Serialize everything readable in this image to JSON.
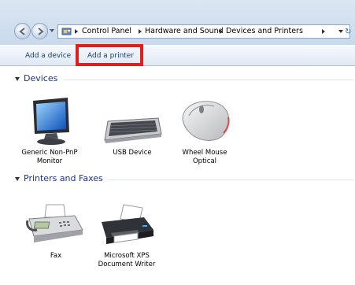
{
  "breadcrumb": [
    "Control Panel",
    "Hardware and Sound",
    "Devices and Printers"
  ],
  "toolbar": {
    "add_device": "Add a device",
    "add_printer": "Add a printer"
  },
  "groups": {
    "devices": {
      "title": "Devices",
      "items": [
        {
          "label": "Generic Non-PnP Monitor",
          "icon": "monitor-icon"
        },
        {
          "label": "USB Device",
          "icon": "keyboard-icon"
        },
        {
          "label": "Wheel Mouse Optical",
          "icon": "mouse-icon"
        }
      ]
    },
    "printers": {
      "title": "Printers and Faxes",
      "items": [
        {
          "label": "Fax",
          "icon": "fax-icon"
        },
        {
          "label": "Microsoft XPS Document Writer",
          "icon": "printer-icon"
        }
      ]
    }
  },
  "colors": {
    "highlight": "#e21d1d",
    "group_title": "#1e3287",
    "toolbar_text": "#1e395b"
  }
}
